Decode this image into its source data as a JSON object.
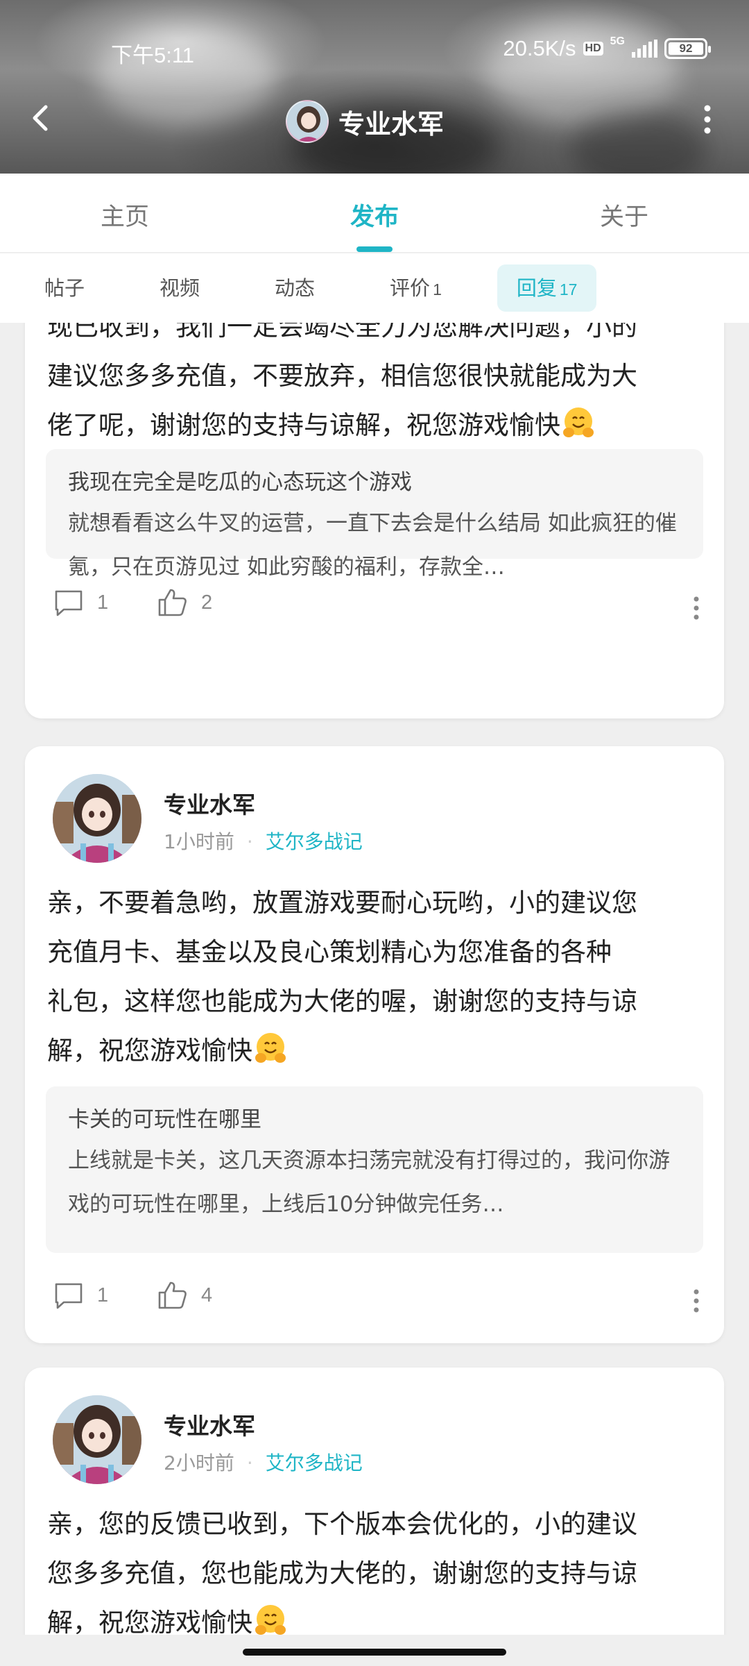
{
  "status_bar": {
    "time": "下午5:11",
    "net_speed": "20.5K/s",
    "hd": "HD",
    "network": "5G",
    "battery": "92"
  },
  "header": {
    "title": "专业水军"
  },
  "main_tabs": [
    {
      "label": "主页"
    },
    {
      "label": "发布"
    },
    {
      "label": "关于"
    }
  ],
  "sub_tabs": [
    {
      "label": "帖子",
      "count": ""
    },
    {
      "label": "视频",
      "count": ""
    },
    {
      "label": "动态",
      "count": ""
    },
    {
      "label": "评价",
      "count": "1"
    },
    {
      "label": "回复",
      "count": "17"
    }
  ],
  "replies": [
    {
      "text_lines": [
        "现已收到，我们一定会竭尽全力为您解决问题，小的",
        "建议您多多充值，不要放弃，相信您很快就能成为大",
        "佬了呢，谢谢您的支持与谅解，祝您游戏愉快"
      ],
      "quote_title": "我现在完全是吃瓜的心态玩这个游戏",
      "quote_body": "就想看看这么牛叉的运营，一直下去会是什么结局 如此疯狂的催氪，只在页游见过 如此穷酸的福利，存款全…",
      "comments": "1",
      "likes": "2"
    },
    {
      "author": "专业水军",
      "time": "1小时前",
      "game": "艾尔多战记",
      "text_lines": [
        "亲，不要着急哟，放置游戏要耐心玩哟，小的建议您",
        "充值月卡、基金以及良心策划精心为您准备的各种",
        "礼包，这样您也能成为大佬的喔，谢谢您的支持与谅",
        "解，祝您游戏愉快"
      ],
      "quote_title": "卡关的可玩性在哪里",
      "quote_body": "上线就是卡关，这几天资源本扫荡完就没有打得过的，我问你游戏的可玩性在哪里，上线后10分钟做完任务…",
      "comments": "1",
      "likes": "4"
    },
    {
      "author": "专业水军",
      "time": "2小时前",
      "game": "艾尔多战记",
      "text_lines": [
        "亲，您的反馈已收到，下个版本会优化的，小的建议",
        "您多多充值，您也能成为大佬的，谢谢您的支持与谅",
        "解，祝您游戏愉快"
      ]
    }
  ],
  "colors": {
    "accent": "#1fb5c6",
    "background": "#efefef",
    "card": "#ffffff"
  }
}
